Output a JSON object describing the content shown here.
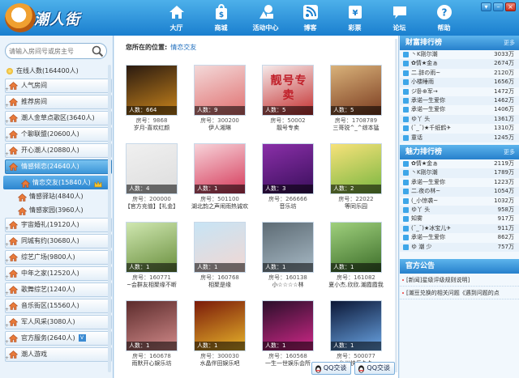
{
  "app": {
    "logo_text": "潮人街"
  },
  "nav": [
    {
      "label": "大厅",
      "icon": "home-icon"
    },
    {
      "label": "商城",
      "icon": "shopping-bag-icon"
    },
    {
      "label": "活动中心",
      "icon": "activity-shapes-icon"
    },
    {
      "label": "博客",
      "icon": "rss-icon"
    },
    {
      "label": "彩票",
      "icon": "lottery-ticket-icon"
    },
    {
      "label": "论坛",
      "icon": "chat-bubble-icon"
    },
    {
      "label": "帮助",
      "icon": "help-icon"
    }
  ],
  "search": {
    "placeholder": "请输入房间号或房主号"
  },
  "sidebar": {
    "online": "在线人数(164400人)",
    "items": [
      {
        "label": "人气房间",
        "level": 0,
        "selected": false
      },
      {
        "label": "推荐房间",
        "level": 0,
        "selected": false
      },
      {
        "label": "潮人金草点歌区(3640人)",
        "level": 0,
        "selected": false
      },
      {
        "label": "个聊联盟(20600人)",
        "level": 0,
        "selected": false
      },
      {
        "label": "开心潮人(20880人)",
        "level": 0,
        "selected": false
      },
      {
        "label": "情感倾恋(24640人)",
        "level": 0,
        "selected": true
      },
      {
        "label": "情恋交友(15840人)",
        "level": 1,
        "selected": true,
        "crown": true
      },
      {
        "label": "情感驿站(4840人)",
        "level": 1,
        "selected": false
      },
      {
        "label": "情感家园(3960人)",
        "level": 1,
        "selected": false
      },
      {
        "label": "宇宙婚礼(19120人)",
        "level": 0,
        "selected": false
      },
      {
        "label": "同城有约(30680人)",
        "level": 0,
        "selected": false
      },
      {
        "label": "综艺广场(9800人)",
        "level": 0,
        "selected": false
      },
      {
        "label": "中年之家(12520人)",
        "level": 0,
        "selected": false
      },
      {
        "label": "歌舞综艺(1240人)",
        "level": 0,
        "selected": false
      },
      {
        "label": "音乐街区(15560人)",
        "level": 0,
        "selected": false
      },
      {
        "label": "军人风采(3080人)",
        "level": 0,
        "selected": false
      },
      {
        "label": "官方服务(2640人)",
        "level": 0,
        "selected": false,
        "badge": "V"
      },
      {
        "label": "潮人游戏",
        "level": 0,
        "selected": false
      }
    ]
  },
  "breadcrumb": {
    "label": "您所在的位置:",
    "current": "情恋交友"
  },
  "rooms": [
    {
      "count": "人数：664",
      "room_no": "房号：9868",
      "name": "岁月-喜欢红颜",
      "colors": [
        "#2a1a10",
        "#c8841c"
      ]
    },
    {
      "count": "人数：9",
      "room_no": "房号：300200",
      "name": "伊人湘琳",
      "colors": [
        "#f3d9d9",
        "#e07070"
      ]
    },
    {
      "count": "人数：5",
      "room_no": "房号：50002",
      "name": "靓号专卖",
      "colors": [
        "#f5eaea",
        "#c43030"
      ],
      "text": "靓号专卖"
    },
    {
      "count": "人数：5",
      "room_no": "房号：1708789",
      "name": "三哥锐^_^综本猛",
      "colors": [
        "#d9b27a",
        "#7b3c20"
      ]
    },
    {
      "count": "人数：4",
      "room_no": "房号：200000",
      "name": "【官方充值】【礼金】",
      "colors": [
        "#f0f0f0",
        "#dddddd"
      ]
    },
    {
      "count": "人数：1",
      "room_no": "房号：501100",
      "name": "湖北韵之声闹雨热诚欢",
      "colors": [
        "#f7d3d9",
        "#d53a5a"
      ]
    },
    {
      "count": "人数：3",
      "room_no": "房号：266666",
      "name": "音乐坊",
      "colors": [
        "#8a2fa8",
        "#3a0f5c"
      ]
    },
    {
      "count": "人数：2",
      "room_no": "房号：22022",
      "name": "等同乐园",
      "colors": [
        "#f7e27a",
        "#79b640"
      ]
    },
    {
      "count": "人数：1",
      "room_no": "房号：160771",
      "name": "~会群友相聚缘不断",
      "colors": [
        "#cfe7b0",
        "#6a8f3e"
      ]
    },
    {
      "count": "人数：1",
      "room_no": "房号：160768",
      "name": "相聚是缘",
      "colors": [
        "#c7e4f5",
        "#f2d7d2"
      ]
    },
    {
      "count": "人数：1",
      "room_no": "房号：160138",
      "name": "小☆☆☆☆林",
      "colors": [
        "#5d6b74",
        "#a7b9c5"
      ]
    },
    {
      "count": "人数：1",
      "room_no": "房号：161082",
      "name": "夏小杰.欣欣.潮霞霞我",
      "colors": [
        "#9fd07d",
        "#3d6e2a"
      ]
    },
    {
      "count": "人数：1",
      "room_no": "房号：160678",
      "name": "雨默开心娱乐坊",
      "colors": [
        "#5c2c2c",
        "#d28a8a"
      ]
    },
    {
      "count": "人数：1",
      "room_no": "房号：300030",
      "name": "水晶伴田娱乐吧",
      "colors": [
        "#7a1a0a",
        "#e7b42a"
      ]
    },
    {
      "count": "人数：1",
      "room_no": "房号：160568",
      "name": "一生一世娱乐会所",
      "colors": [
        "#2a0f2a",
        "#d02888"
      ]
    },
    {
      "count": "人数：1",
      "room_no": "房号：500077",
      "name": "台州快乐久久",
      "colors": [
        "#0b1736",
        "#6aa5e5"
      ]
    }
  ],
  "qq_buttons": [
    "QQ交谈",
    "QQ交谈"
  ],
  "wealth": {
    "title": "财富排行榜",
    "more": "更多",
    "rows": [
      {
        "name": "丶K刚尔潮",
        "value": "3033万"
      },
      {
        "name": "✿情★金ぁ",
        "value": "2674万"
      },
      {
        "name": "二.辞の雨~",
        "value": "2120万"
      },
      {
        "name": "小楼睡雨",
        "value": "1656万"
      },
      {
        "name": "ジ卧⊕军→",
        "value": "1472万"
      },
      {
        "name": "承诺一生爱你",
        "value": "1462万"
      },
      {
        "name": "承诺一生爱你",
        "value": "1406万"
      },
      {
        "name": "ゆ丫 头",
        "value": "1361万"
      },
      {
        "name": "(ˉ_ˉ)★千纸鹤✈",
        "value": "1310万"
      },
      {
        "name": "童话",
        "value": "1245万"
      }
    ]
  },
  "charm": {
    "title": "魅力排行榜",
    "more": "更多",
    "rows": [
      {
        "name": "✿情★金ぁ",
        "value": "2119万"
      },
      {
        "name": "丶K刚尔潮",
        "value": "1789万"
      },
      {
        "name": "承诺一生爱你",
        "value": "1223万"
      },
      {
        "name": "二.夜の林~",
        "value": "1054万"
      },
      {
        "name": "(_小惊袭~",
        "value": "1032万"
      },
      {
        "name": "ゆ丫 头",
        "value": "958万"
      },
      {
        "name": "知雾",
        "value": "917万"
      },
      {
        "name": "(ˉ_ˉ)★冰宝儿✈",
        "value": "911万"
      },
      {
        "name": "承诺一生爱你",
        "value": "862万"
      },
      {
        "name": "ゆ 潮 少",
        "value": "757万"
      }
    ]
  },
  "announcement": {
    "title": "官方公告",
    "items": [
      "[新闻]星级评级规则说明]",
      "[潮豆兑换的相关问题《遇到问题的点"
    ]
  }
}
